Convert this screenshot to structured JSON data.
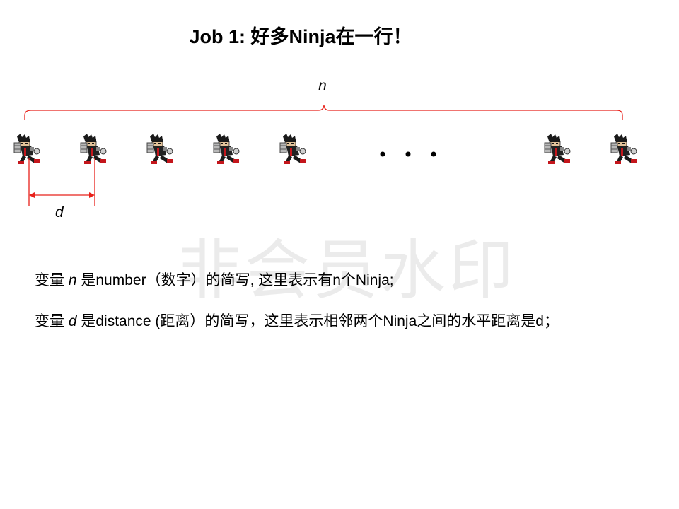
{
  "title": "Job 1: 好多Ninja在一行！",
  "labels": {
    "n": "n",
    "d": "d"
  },
  "watermark": "非会员水印",
  "ellipsis": "• • •",
  "lines": [
    {
      "pre": "变量 ",
      "var": "n",
      "post": " 是number（数字）的简写, 这里表示有n个Ninja;"
    },
    {
      "pre": "变量 ",
      "var": "d",
      "post": " 是distance (距离）的简写，这里表示相邻两个Ninja之间的水平距离是d；"
    }
  ],
  "colors": {
    "accent": "#e8211a",
    "text": "#000000",
    "watermark": "#ebebeb"
  },
  "ninja_count_shown": 7,
  "icon": "ninja-sprite-icon"
}
